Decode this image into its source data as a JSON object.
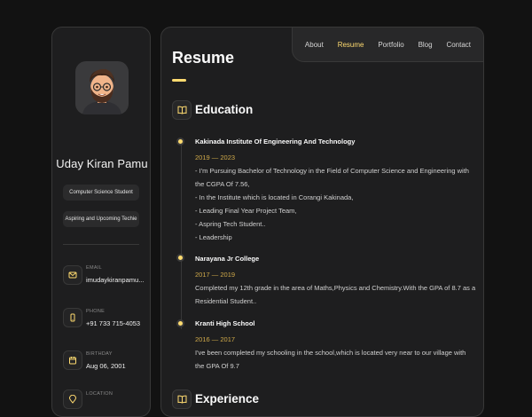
{
  "sidebar": {
    "name": "Uday Kiran Pamu",
    "badges": [
      "Computer Science Student",
      "Aspiring and Upcoming Techie"
    ],
    "contacts": [
      {
        "title": "EMAIL",
        "value": "imudaykiranpamu...",
        "icon": "mail-icon"
      },
      {
        "title": "PHONE",
        "value": "+91 733 715-4053",
        "icon": "phone-icon"
      },
      {
        "title": "BIRTHDAY",
        "value": "Aug 06, 2001",
        "icon": "calendar-icon"
      },
      {
        "title": "LOCATION",
        "value": "",
        "icon": "location-icon"
      }
    ]
  },
  "nav": {
    "items": [
      "About",
      "Resume",
      "Portfolio",
      "Blog",
      "Contact"
    ],
    "active": "Resume"
  },
  "main": {
    "title": "Resume",
    "education": {
      "heading": "Education",
      "items": [
        {
          "title": "Kakinada Institute Of Engineering And Technology",
          "date": "2019 — 2023",
          "lines": [
            "- I'm Pursuing Bachelor of Technology in the Field of Computer Science and Engineering with",
            "the CGPA Of 7.56,",
            "- In the Institute which is located in Corangi Kakinada,",
            "- Leading Final Year Project Team,",
            "- Aspring Tech Student..",
            "- Leadership"
          ]
        },
        {
          "title": "Narayana Jr College",
          "date": "2017 — 2019",
          "lines": [
            "Completed my 12th grade in the area of Maths,Physics and Chemistry.With the GPA of 8.7 as a",
            "Residential Student.."
          ]
        },
        {
          "title": "Kranti High School",
          "date": "2016 — 2017",
          "lines": [
            "I've been completed my schooling in the school,which is located very near to our village with",
            "the GPA Of 9.7"
          ]
        }
      ]
    },
    "experience": {
      "heading": "Experience"
    }
  },
  "colors": {
    "accent": "#ffdb70",
    "background": "#121212",
    "card": "#1e1e1f"
  }
}
